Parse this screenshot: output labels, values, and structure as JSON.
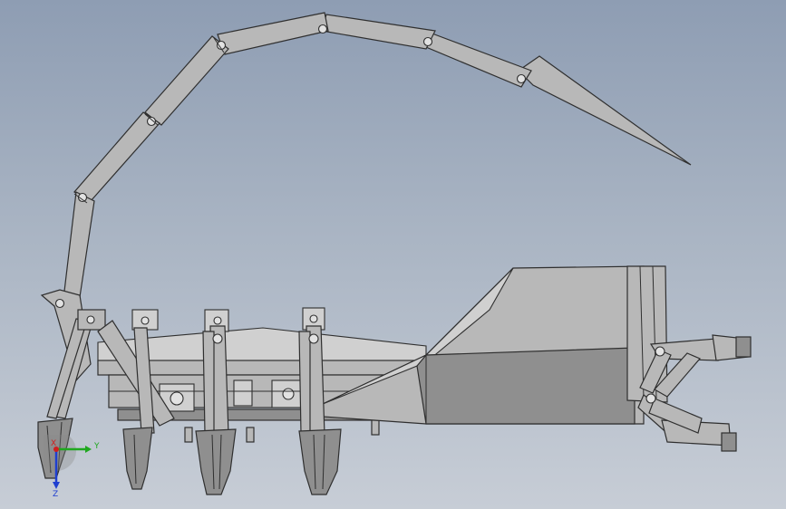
{
  "viewport": {
    "background_top": "#8e9db3",
    "background_bottom": "#c7cdd6",
    "part_color": "#b8b8b8",
    "outline_color": "#2f2f2f"
  },
  "model": {
    "parts": [
      "scorpion-tail",
      "tail-stinger",
      "body-platform",
      "front-cover",
      "pincer-claws",
      "left-leg",
      "middle-leg",
      "right-leg",
      "rear-claw"
    ]
  },
  "triad": {
    "y_label": "Y",
    "z_label": "Z",
    "x_label": "X",
    "y_color": "#1fa81f",
    "z_color": "#1f3fd0",
    "x_color": "#d01f1f"
  }
}
